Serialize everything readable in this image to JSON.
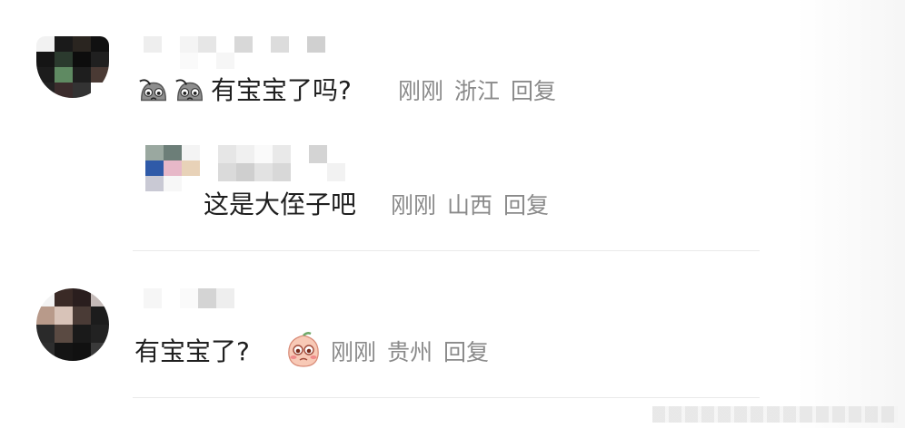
{
  "comments": [
    {
      "text": "有宝宝了吗?",
      "emoji_prefix": [
        "crying-face-icon",
        "crying-face-icon"
      ],
      "time": "刚刚",
      "location": "浙江",
      "reply_label": "回复"
    },
    {
      "text": "这是大侄子吧",
      "time": "刚刚",
      "location": "山西",
      "reply_label": "回复",
      "is_nested_reply": true
    },
    {
      "text": "有宝宝了?",
      "emoji_suffix": "peach-shy-face-icon",
      "time": "刚刚",
      "location": "贵州",
      "reply_label": "回复"
    }
  ],
  "colors": {
    "text": "#1f1f1f",
    "meta": "#8a8a8a",
    "divider": "#eaeaea"
  }
}
